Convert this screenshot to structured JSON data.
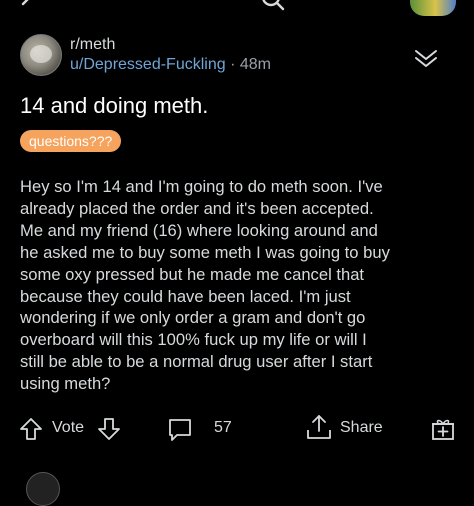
{
  "header": {
    "subreddit": "r/meth",
    "username": "u/Depressed-Fuckling",
    "separator": "·",
    "time_ago": "48m"
  },
  "post": {
    "title": "14 and doing meth.",
    "flair": "questions???",
    "body_lines": [
      "Hey so I'm 14 and I'm going to do meth soon. I've",
      "already placed the order and it's been accepted.",
      "Me and my friend (16) where looking around and",
      "he asked me to buy some meth I was going to buy",
      "some oxy pressed but he made me cancel that",
      "because they could have been laced. I'm just",
      "wondering if we only order a gram and don't go",
      "overboard will this 100% fuck up my life or will I",
      "still be able to be a normal drug user after I start",
      "using meth?"
    ]
  },
  "actions": {
    "vote_label": "Vote",
    "comment_count": "57",
    "share_label": "Share"
  },
  "icons": {
    "back": "back-arrow-icon",
    "search": "search-icon",
    "collapse": "chevron-down-icon",
    "upvote": "upvote-arrow-icon",
    "downvote": "downvote-arrow-icon",
    "comments": "comment-bubble-icon",
    "share": "share-icon",
    "award": "award-icon"
  },
  "colors": {
    "background": "#000000",
    "text": "#d7dadc",
    "username": "#6ea6d7",
    "flair": "#f5a35d"
  }
}
